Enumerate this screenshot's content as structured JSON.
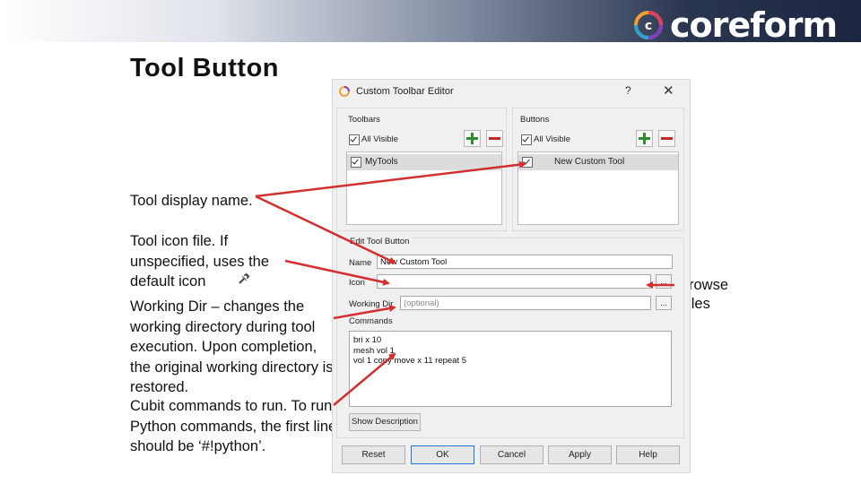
{
  "brand": {
    "logo_text": "coreform"
  },
  "slide": {
    "title": "Tool Button",
    "notes": [
      "Tool display name.",
      "Tool icon file. If unspecified, uses the default icon",
      "Working Dir – changes the working directory during tool execution. Upon completion, the original working directory is restored.",
      "Cubit commands to run. To run Python commands, the first line should be ‘#!python’."
    ],
    "browse_note": "Browse Files"
  },
  "dialog": {
    "title": "Custom Toolbar Editor",
    "help_label": "?",
    "close_label": "✕",
    "toolbars": {
      "label": "Toolbars",
      "all_visible_label": "All Visible",
      "items": [
        "MyTools"
      ]
    },
    "buttons": {
      "label": "Buttons",
      "all_visible_label": "All Visible",
      "items": [
        "New Custom Tool"
      ]
    },
    "edit_tool_button": {
      "label": "Edit Tool Button",
      "name_label": "Name",
      "name_value": "New Custom Tool",
      "icon_label": "Icon",
      "icon_value": "",
      "working_dir_label": "Working Dir",
      "working_dir_placeholder": "(optional)",
      "browse_label": "...",
      "commands_label": "Commands",
      "commands": [
        "bri x 10",
        "mesh vol 1",
        "vol 1 copy move x 11 repeat 5"
      ],
      "show_description_label": "Show Description"
    },
    "footer_buttons": [
      "Reset",
      "OK",
      "Cancel",
      "Apply",
      "Help"
    ]
  },
  "colors": {
    "accent_arrow": "#d32f2f",
    "plus": "#2e8b2e",
    "minus": "#c62828"
  }
}
